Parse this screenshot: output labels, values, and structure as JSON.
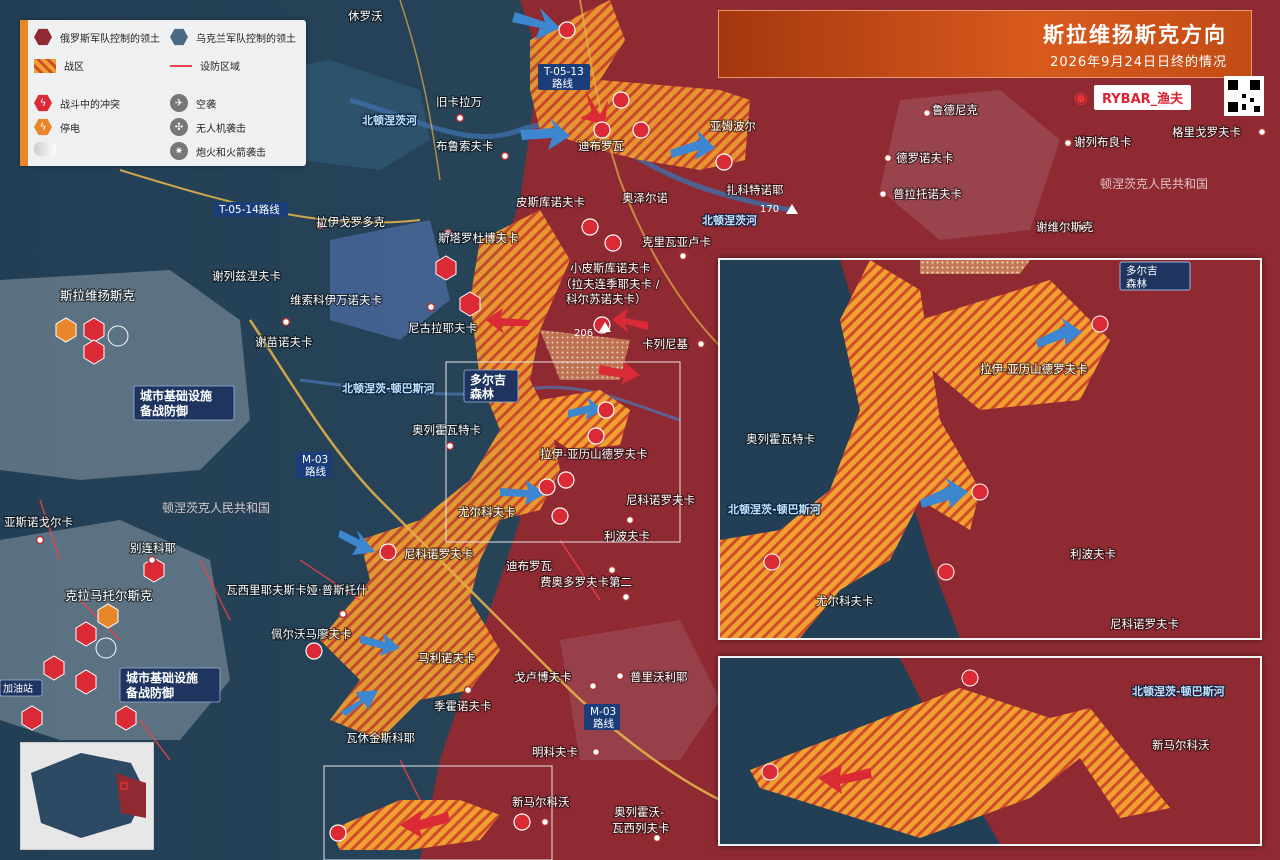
{
  "header": {
    "title": "斯拉维扬斯克方向",
    "subtitle": "2026年9月24日日终的情况"
  },
  "brand": {
    "name": "RYBAR_渔夫"
  },
  "legend": {
    "ru_territory": "俄罗斯军队控制的领土",
    "ua_territory": "乌克兰军队控制的领土",
    "combat_zone": "战区",
    "fortified_area": "设防区域",
    "clash": "战斗中的冲突",
    "power_outage": "停电",
    "airstrike": "空袭",
    "drone_attack": "无人机袭击",
    "artillery": "炮火和火箭袭击"
  },
  "colors": {
    "ru": "#8f2a33",
    "ua": "#233f55",
    "combat": "#f0a030",
    "clash": "#d92a35",
    "accent": "#e8872a"
  },
  "places": {
    "khrystoforivka": "休罗沃",
    "staryi_karavan": "旧卡拉万",
    "brusivka": "布鲁索夫卡",
    "raihorodok": "拉伊戈罗多克",
    "starodubivka": "斯塔罗杜博夫卡",
    "serebryanka": "谢列兹涅夫卡",
    "sloviansk": "斯拉维扬斯克",
    "vysokopillia": "维索科伊万诺夫卡",
    "semenivka": "谢苗诺夫卡",
    "mykolaivka": "尼古拉耶夫卡",
    "orikhovatka": "奥列霍瓦特卡",
    "yasnohorka": "亚斯诺戈尔卡",
    "bilenke": "别连科耶",
    "kramatorsk": "克拉马托尔斯克",
    "vasylivska_pustosh": "瓦西里耶夫斯卡娅·普斯托什",
    "pervomaiske": "佩尔沃马廖夫卡",
    "malynivka": "马利诺夫卡",
    "sofiivka": "季霍诺夫卡",
    "vasiukivka": "瓦休金斯科耶",
    "dibrova": "迪布罗瓦",
    "yampil": "亚姆波尔",
    "ozerne": "奥泽尔诺",
    "zakitne": "扎科特诺耶",
    "piskunivka": "皮斯库诺夫卡",
    "kryva_luka": "克里瓦亚卢卡",
    "mala_piskunivka": "小皮斯库诺夫卡",
    "mala_piskunivka_alt": "（拉夫连季耶夫卡 /",
    "mala_piskunivka_alt2": "科尔苏诺夫卡）",
    "kolodiazi": "卡列尼基",
    "raiy_oleksandrivka": "拉伊-亚历山德罗夫卡",
    "nykyforivka": "尼科诺罗夫卡",
    "yurkivka": "尤尔科夫卡",
    "lypivka": "利波夫卡",
    "nykyforivka_w": "尼科诺罗夫卡",
    "dibrova_s": "迪布罗瓦",
    "fedorivka2": "费奥多罗夫卡第二",
    "hlukhovka": "戈卢博夫卡",
    "prelesne": "普里沃利耶",
    "mintse": "明科夫卡",
    "nove_markove": "新马尔科沃",
    "orikhovo_vasylivka": "奥列霍沃-",
    "orikhovo_vasylivka2": "瓦西列夫卡",
    "rudnyky": "鲁德尼克",
    "derylove": "德罗诺夫卡",
    "siversk_area": "谢列布良卡",
    "platonivka": "普拉托诺夫卡",
    "serebrianka": "谢维尔斯克",
    "hryhorivka": "格里戈罗夫卡"
  },
  "rivers": {
    "north_donets_1": "北顿涅茨河",
    "north_donets_2": "北顿涅茨河",
    "canal": "北顿涅茨-顿巴斯河"
  },
  "regions": {
    "dpr_east": "顿涅茨克人民共和国",
    "dpr_west": "顿涅茨克人民共和国"
  },
  "roads": {
    "t0513": "T-05-13",
    "t0513_sub": "路线",
    "t0514": "T-05-14路线",
    "m03a": "M-03",
    "m03a_sub": "路线",
    "m03b": "M-03",
    "m03b_sub": "路线"
  },
  "callouts": {
    "forest_1": "多尔吉",
    "forest_2": "森林",
    "infra_1a": "城市基础设施",
    "infra_1b": "备战防御",
    "infra_2a": "城市基础设施",
    "infra_2b": "备战防御",
    "gas_station": "加油站"
  },
  "heights": {
    "h170": "170",
    "h206": "206"
  },
  "inset1": {
    "forest_1": "多尔吉",
    "forest_2": "森林",
    "raiy": "拉伊-亚历山德罗夫卡",
    "orikhovatka": "奥列霍瓦特卡",
    "canal": "北顿涅茨-顿巴斯河",
    "lypivka": "利波夫卡",
    "yurkivka": "尤尔科夫卡",
    "nykyforivka": "尼科诺罗夫卡"
  },
  "inset2": {
    "canal": "北顿涅茨-顿巴斯河",
    "nove_markove": "新马尔科沃"
  }
}
